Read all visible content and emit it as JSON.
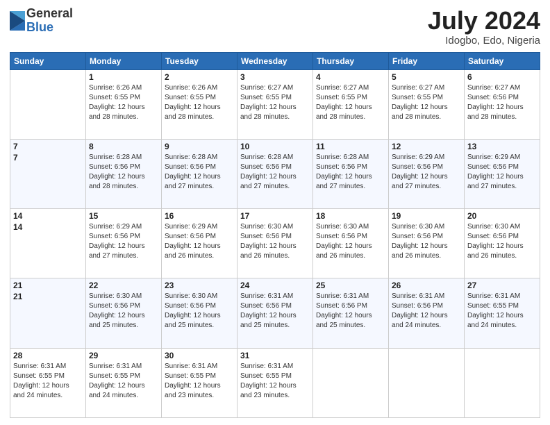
{
  "logo": {
    "general": "General",
    "blue": "Blue"
  },
  "title": {
    "month": "July 2024",
    "location": "Idogbo, Edo, Nigeria"
  },
  "days_of_week": [
    "Sunday",
    "Monday",
    "Tuesday",
    "Wednesday",
    "Thursday",
    "Friday",
    "Saturday"
  ],
  "weeks": [
    [
      {
        "day": "",
        "info": ""
      },
      {
        "day": "1",
        "info": "Sunrise: 6:26 AM\nSunset: 6:55 PM\nDaylight: 12 hours\nand 28 minutes."
      },
      {
        "day": "2",
        "info": "Sunrise: 6:26 AM\nSunset: 6:55 PM\nDaylight: 12 hours\nand 28 minutes."
      },
      {
        "day": "3",
        "info": "Sunrise: 6:27 AM\nSunset: 6:55 PM\nDaylight: 12 hours\nand 28 minutes."
      },
      {
        "day": "4",
        "info": "Sunrise: 6:27 AM\nSunset: 6:55 PM\nDaylight: 12 hours\nand 28 minutes."
      },
      {
        "day": "5",
        "info": "Sunrise: 6:27 AM\nSunset: 6:55 PM\nDaylight: 12 hours\nand 28 minutes."
      },
      {
        "day": "6",
        "info": "Sunrise: 6:27 AM\nSunset: 6:56 PM\nDaylight: 12 hours\nand 28 minutes."
      }
    ],
    [
      {
        "day": "7",
        "info": ""
      },
      {
        "day": "8",
        "info": "Sunrise: 6:28 AM\nSunset: 6:56 PM\nDaylight: 12 hours\nand 28 minutes."
      },
      {
        "day": "9",
        "info": "Sunrise: 6:28 AM\nSunset: 6:56 PM\nDaylight: 12 hours\nand 27 minutes."
      },
      {
        "day": "10",
        "info": "Sunrise: 6:28 AM\nSunset: 6:56 PM\nDaylight: 12 hours\nand 27 minutes."
      },
      {
        "day": "11",
        "info": "Sunrise: 6:28 AM\nSunset: 6:56 PM\nDaylight: 12 hours\nand 27 minutes."
      },
      {
        "day": "12",
        "info": "Sunrise: 6:29 AM\nSunset: 6:56 PM\nDaylight: 12 hours\nand 27 minutes."
      },
      {
        "day": "13",
        "info": "Sunrise: 6:29 AM\nSunset: 6:56 PM\nDaylight: 12 hours\nand 27 minutes."
      }
    ],
    [
      {
        "day": "14",
        "info": ""
      },
      {
        "day": "15",
        "info": "Sunrise: 6:29 AM\nSunset: 6:56 PM\nDaylight: 12 hours\nand 27 minutes."
      },
      {
        "day": "16",
        "info": "Sunrise: 6:29 AM\nSunset: 6:56 PM\nDaylight: 12 hours\nand 26 minutes."
      },
      {
        "day": "17",
        "info": "Sunrise: 6:30 AM\nSunset: 6:56 PM\nDaylight: 12 hours\nand 26 minutes."
      },
      {
        "day": "18",
        "info": "Sunrise: 6:30 AM\nSunset: 6:56 PM\nDaylight: 12 hours\nand 26 minutes."
      },
      {
        "day": "19",
        "info": "Sunrise: 6:30 AM\nSunset: 6:56 PM\nDaylight: 12 hours\nand 26 minutes."
      },
      {
        "day": "20",
        "info": "Sunrise: 6:30 AM\nSunset: 6:56 PM\nDaylight: 12 hours\nand 26 minutes."
      }
    ],
    [
      {
        "day": "21",
        "info": ""
      },
      {
        "day": "22",
        "info": "Sunrise: 6:30 AM\nSunset: 6:56 PM\nDaylight: 12 hours\nand 25 minutes."
      },
      {
        "day": "23",
        "info": "Sunrise: 6:30 AM\nSunset: 6:56 PM\nDaylight: 12 hours\nand 25 minutes."
      },
      {
        "day": "24",
        "info": "Sunrise: 6:31 AM\nSunset: 6:56 PM\nDaylight: 12 hours\nand 25 minutes."
      },
      {
        "day": "25",
        "info": "Sunrise: 6:31 AM\nSunset: 6:56 PM\nDaylight: 12 hours\nand 25 minutes."
      },
      {
        "day": "26",
        "info": "Sunrise: 6:31 AM\nSunset: 6:56 PM\nDaylight: 12 hours\nand 24 minutes."
      },
      {
        "day": "27",
        "info": "Sunrise: 6:31 AM\nSunset: 6:55 PM\nDaylight: 12 hours\nand 24 minutes."
      }
    ],
    [
      {
        "day": "28",
        "info": "Sunrise: 6:31 AM\nSunset: 6:55 PM\nDaylight: 12 hours\nand 24 minutes."
      },
      {
        "day": "29",
        "info": "Sunrise: 6:31 AM\nSunset: 6:55 PM\nDaylight: 12 hours\nand 24 minutes."
      },
      {
        "day": "30",
        "info": "Sunrise: 6:31 AM\nSunset: 6:55 PM\nDaylight: 12 hours\nand 23 minutes."
      },
      {
        "day": "31",
        "info": "Sunrise: 6:31 AM\nSunset: 6:55 PM\nDaylight: 12 hours\nand 23 minutes."
      },
      {
        "day": "",
        "info": ""
      },
      {
        "day": "",
        "info": ""
      },
      {
        "day": "",
        "info": ""
      }
    ]
  ]
}
